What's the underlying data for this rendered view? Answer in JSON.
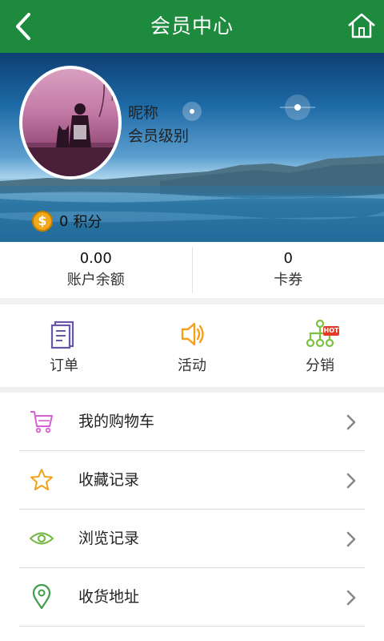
{
  "header": {
    "title": "会员中心",
    "back_icon": "chevron-left-icon",
    "home_icon": "home-icon",
    "color": "#1e8a3e"
  },
  "profile": {
    "nickname": "昵称",
    "level": "会员级别",
    "points_value": "0",
    "points_label": "积分",
    "coin_icon": "coin-icon",
    "coin_glyph": "$"
  },
  "stats": [
    {
      "value": "0.00",
      "label": "账户余额"
    },
    {
      "value": "0",
      "label": "卡券"
    }
  ],
  "quick_actions": [
    {
      "label": "订单",
      "icon": "order-icon",
      "color": "#6a56a8"
    },
    {
      "label": "活动",
      "icon": "speaker-icon",
      "color": "#f1a11a"
    },
    {
      "label": "分销",
      "icon": "distribution-icon",
      "color": "#7cc242",
      "badge": "HOT"
    }
  ],
  "menu": [
    {
      "label": "我的购物车",
      "icon": "cart-icon",
      "color": "#d65fd2"
    },
    {
      "label": "收藏记录",
      "icon": "star-icon",
      "color": "#f0a21a"
    },
    {
      "label": "浏览记录",
      "icon": "eye-icon",
      "color": "#79b84a"
    },
    {
      "label": "收货地址",
      "icon": "location-pin-icon",
      "color": "#3f9e4d"
    }
  ]
}
